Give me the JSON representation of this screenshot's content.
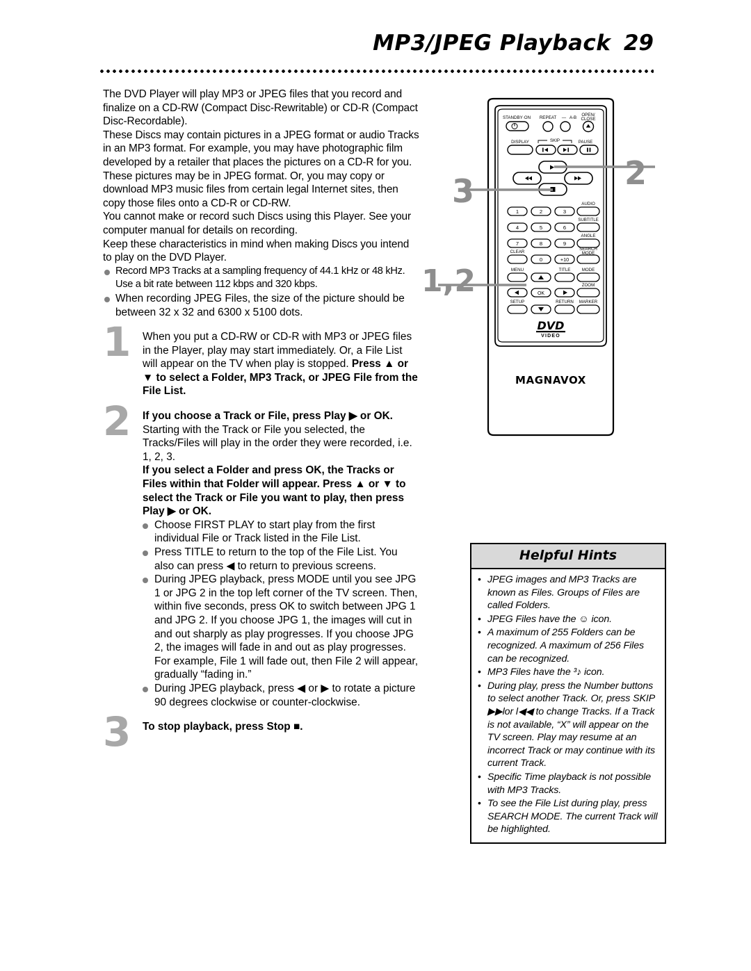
{
  "header": {
    "title": "MP3/JPEG Playback",
    "page_number": "29"
  },
  "intro": {
    "paragraphs": [
      "The DVD Player will play MP3 or JPEG files that you record and finalize on a CD-RW (Compact Disc-Rewritable) or CD-R (Compact Disc-Recordable).",
      "These Discs may contain pictures in a JPEG format or audio Tracks in an MP3 format. For example, you may have photographic film developed by a retailer that places the pictures on a CD-R for you. These pictures may be in JPEG format. Or, you may copy or download MP3 music files from certain legal Internet sites, then copy those files onto a CD-R or CD-RW.",
      "You cannot make or record such Discs using this Player. See your computer manual for details on recording.",
      "Keep these characteristics in mind when making Discs you intend to play on the DVD Player."
    ],
    "bullets": [
      "Record MP3 Tracks at a sampling frequency of 44.1 kHz or 48 kHz. Use a bit rate between 112 kbps and 320 kbps.",
      "When recording JPEG Files, the size of the picture should be between 32 x 32 and 6300 x 5100 dots."
    ]
  },
  "steps": [
    {
      "number": "1",
      "normal_1": "When you put a CD-RW or CD-R with MP3 or JPEG files in the Player, play may start immediately. Or, a File List will appear on the TV when play is stopped. ",
      "bold_1": "Press ▲ or ▼ to select a Folder, MP3 Track, or JPEG File from the File List."
    },
    {
      "number": "2",
      "bold_1": "If you choose a Track or File, press Play ▶ or OK.",
      "normal_1": " Starting with the Track or File you selected, the Tracks/Files will play in the order they were recorded, i.e. 1, 2, 3.",
      "bold_2": "If you select a Folder and press OK, the Tracks or Files within that Folder will appear. Press ▲ or ▼ to select the Track or File you want to play, then press Play ▶ or OK.",
      "bullets": [
        "Choose FIRST PLAY to start play from the first individual File or Track listed in the File List.",
        "Press TITLE to return to the top of the File List. You also can press ◀ to return to previous screens.",
        "During JPEG playback, press MODE until you see JPG 1 or JPG 2 in the top left corner of the TV screen. Then, within five seconds, press OK to switch between JPG 1 and JPG 2. If you choose JPG 1, the images will cut in and out sharply as play progresses. If you choose JPG 2, the images will fade in and out as play progresses. For example, File 1 will fade out, then File 2 will appear, gradually “fading in.”",
        "During JPEG playback, press ◀ or ▶ to rotate a picture 90 degrees clockwise or counter-clockwise."
      ]
    },
    {
      "number": "3",
      "bold_1": "To stop playback, press Stop ■."
    }
  ],
  "remote": {
    "brand": "MAGNAVOX",
    "disc_logo_main": "DVD",
    "disc_logo_sub": "VIDEO",
    "labels": {
      "standby": "STANDBY·ON",
      "repeat": "REPEAT",
      "repeat_dash": "—",
      "ab": "A-B",
      "open_close_1": "OPEN/",
      "open_close_2": "CLOSE",
      "display": "DISPLAY",
      "skip": "SKIP",
      "pause": "PAUSE",
      "audio": "AUDIO",
      "subtitle": "SUBTITLE",
      "angle": "ANGLE",
      "search_1": "SEARCH",
      "search_2": "MODE",
      "clear": "CLEAR",
      "menu": "MENU",
      "title": "TITLE",
      "mode": "MODE",
      "zoom": "ZOOM",
      "setup": "SETUP",
      "return": "RETURN",
      "marker": "MARKER",
      "ok": "OK",
      "plus_ten": "+10"
    },
    "number_buttons": [
      "1",
      "2",
      "3",
      "4",
      "5",
      "6",
      "7",
      "8",
      "9",
      "0"
    ],
    "callouts": [
      {
        "id": "callout-3",
        "text": "3"
      },
      {
        "id": "callout-2",
        "text": "2"
      },
      {
        "id": "callout-12",
        "text": "1,2"
      }
    ]
  },
  "hints": {
    "title": "Helpful Hints",
    "items": [
      "JPEG images and MP3 Tracks are known as Files. Groups of Files are called Folders.",
      "JPEG Files have the ☺ icon.",
      "A maximum of 255 Folders can be recognized. A maximum of 256 Files can be recognized.",
      "MP3 Files have the ³♪ icon.",
      "During play, press the Number buttons to select another Track. Or, press SKIP ▶▶lor l◀◀ to change Tracks. If a Track is not available, “X” will appear on the TV screen. Play may resume at an incorrect Track or may continue with its current Track.",
      "Specific Time playback is not possible with MP3 Tracks.",
      "To see the File List during play, press SEARCH MODE. The current Track will be highlighted."
    ]
  }
}
